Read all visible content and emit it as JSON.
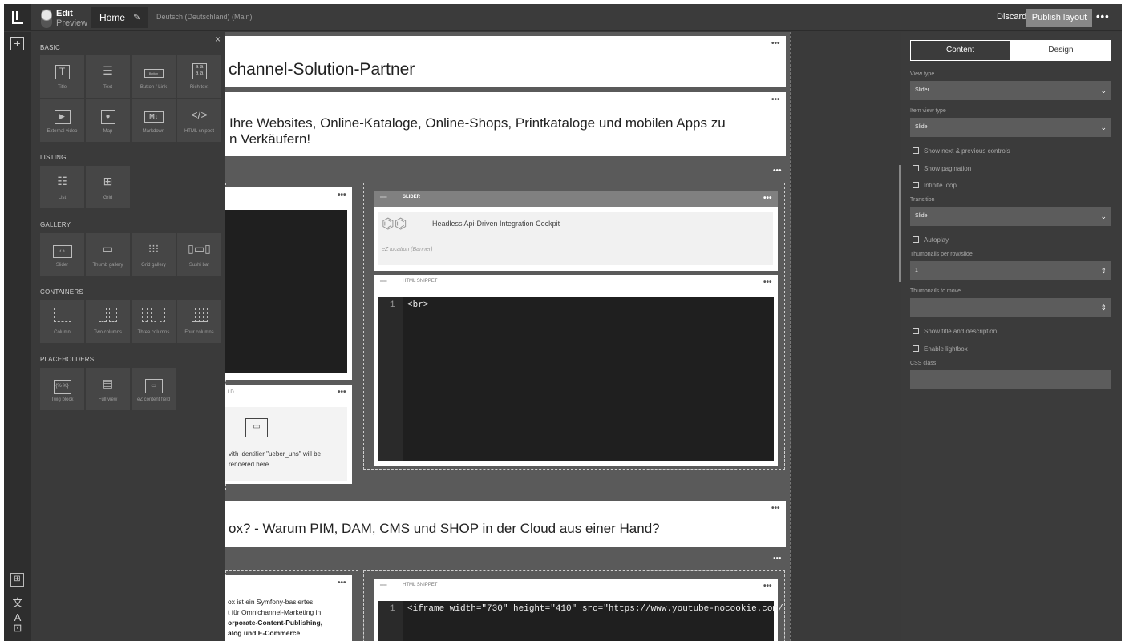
{
  "topbar": {
    "mode_edit": "Edit",
    "mode_preview": "Preview",
    "page_name": "Home",
    "locale": "Deutsch (Deutschland) (Main)",
    "discard": "Discard",
    "publish": "Publish layout",
    "more": "•••"
  },
  "palette": {
    "close": "×",
    "categories": [
      "BASIC",
      "LISTING",
      "GALLERY",
      "CONTAINERS",
      "PLACEHOLDERS"
    ],
    "basic": [
      "Title",
      "Text",
      "Button / Link",
      "Rich text",
      "External video",
      "Map",
      "Markdown",
      "HTML snippet"
    ],
    "listing": [
      "List",
      "Grid"
    ],
    "gallery": [
      "Slider",
      "Thumb gallery",
      "Grid gallery",
      "Sushi bar"
    ],
    "containers": [
      "Column",
      "Two columns",
      "Three columns",
      "Four columns"
    ],
    "placeholders": [
      "Twig block",
      "Full view",
      "eZ content field"
    ],
    "icons": {
      "button_glyph": "Button",
      "richtext_glyph": "a a",
      "richtext_glyph2": "a a",
      "markdown_glyph": "M↓",
      "html_glyph": "</>",
      "twig_glyph": "{% %}"
    }
  },
  "canvas": {
    "more": "•••",
    "title1": "channel-Solution-Partner",
    "title2_line1": "Ihre Websites, Online-Kataloge, Online-Shops, Printkataloge und mobilen Apps zu",
    "title2_line2": "n Verkäufern!",
    "slider_label": "SLIDER",
    "slider_item_title": "Headless Api-Driven Integration Cockpit",
    "slider_item_sub": "eZ location (Banner)",
    "html_snippet_label": "HTML SNIPPET",
    "html_snippet_label2": "HTML SNIPPET",
    "code1_line": "1",
    "code1_text": "<br>",
    "field_label_partial": "LD",
    "field_text_line1": "vith identifier \"ueber_uns\" will be",
    "field_text_line2": "rendered here.",
    "title3": "ox? - Warum PIM, DAM, CMS und SHOP in der Cloud aus einer Hand?",
    "richtext_line1": "ox ist ein Symfony-basiertes",
    "richtext_line2": "t für Omnichannel-Marketing in",
    "richtext_line3": "orporate-Content-Publishing,",
    "richtext_line4": "alog und E-Commerce",
    "richtext_line4_end": ".",
    "code2_line": "1",
    "code2_text": "<iframe width=\"730\" height=\"410\" src=\"https://www.youtube-nocookie.com/"
  },
  "panel": {
    "tab_content": "Content",
    "tab_design": "Design",
    "view_type_label": "View type",
    "view_type_value": "Slider",
    "item_view_type_label": "Item view type",
    "item_view_type_value": "Slide",
    "show_controls": "Show next & previous controls",
    "show_pagination": "Show pagination",
    "infinite_loop": "Infinite loop",
    "transition_label": "Transition",
    "transition_value": "Slide",
    "autoplay": "Autoplay",
    "thumbs_per_row_label": "Thumbnails per row/slide",
    "thumbs_per_row_value": "1",
    "thumbs_to_move_label": "Thumbnails to move",
    "thumbs_to_move_value": "",
    "show_title_desc": "Show title and description",
    "enable_lightbox": "Enable lightbox",
    "css_class_label": "CSS class",
    "css_class_value": ""
  },
  "colors": {
    "frame": "#3a3a3a",
    "canvas": "#5a5a5a",
    "publish": "#888888"
  }
}
